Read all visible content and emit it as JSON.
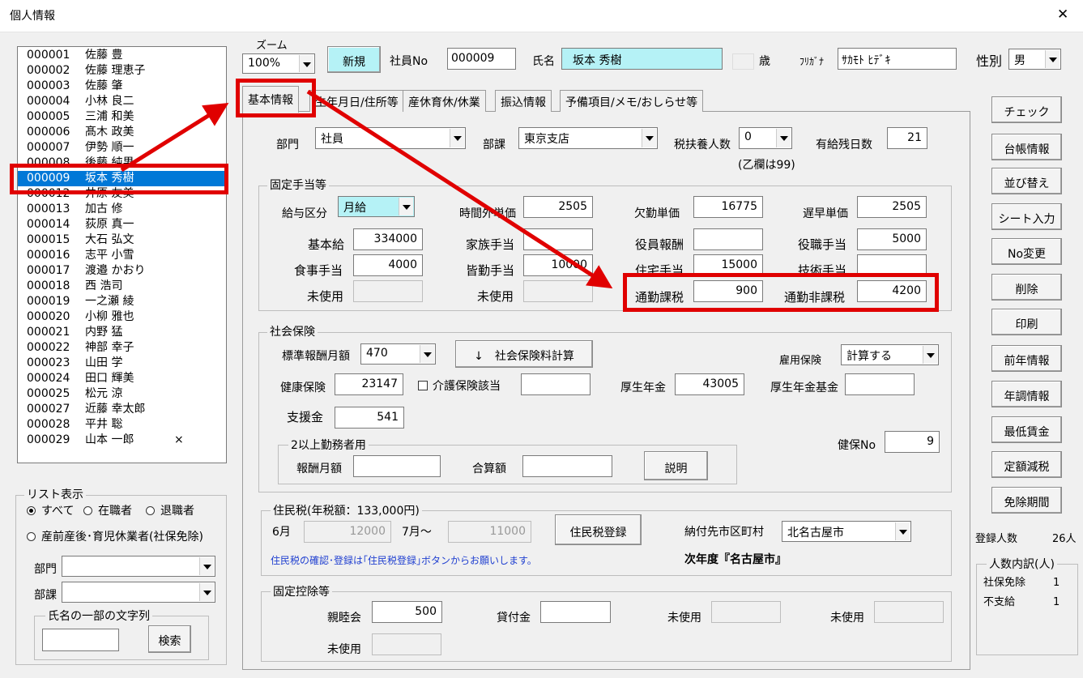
{
  "window": {
    "title": "個人情報",
    "close_glyph": "✕"
  },
  "zoom": {
    "label": "ズーム",
    "value": "100%"
  },
  "header": {
    "new_button": "新規",
    "emp_no_label": "社員No",
    "emp_no": "000009",
    "name_label": "氏名",
    "name": "坂本 秀樹",
    "age_label": "歳",
    "furigana_label": "ﾌﾘｶﾞﾅ",
    "furigana": "ｻｶﾓﾄ ﾋﾃﾞｷ",
    "gender_label": "性別",
    "gender": "男"
  },
  "employees": [
    {
      "no": "000001",
      "name": "佐藤 豊"
    },
    {
      "no": "000002",
      "name": "佐藤 理恵子"
    },
    {
      "no": "000003",
      "name": "佐藤 肇"
    },
    {
      "no": "000004",
      "name": "小林 良二"
    },
    {
      "no": "000005",
      "name": "三浦 和美"
    },
    {
      "no": "000006",
      "name": "髙木 政美"
    },
    {
      "no": "000007",
      "name": "伊勢 順一"
    },
    {
      "no": "000008",
      "name": "後藤 純男"
    },
    {
      "no": "000009",
      "name": "坂本 秀樹"
    },
    {
      "no": "000012",
      "name": "井原 友美"
    },
    {
      "no": "000013",
      "name": "加古 修"
    },
    {
      "no": "000014",
      "name": "荻原 真一"
    },
    {
      "no": "000015",
      "name": "大石 弘文"
    },
    {
      "no": "000016",
      "name": "志平 小雪"
    },
    {
      "no": "000017",
      "name": "渡邉 かおり"
    },
    {
      "no": "000018",
      "name": "西 浩司"
    },
    {
      "no": "000019",
      "name": "一之瀬 綾"
    },
    {
      "no": "000020",
      "name": "小柳 雅也"
    },
    {
      "no": "000021",
      "name": "内野 猛"
    },
    {
      "no": "000022",
      "name": "神部 幸子"
    },
    {
      "no": "000023",
      "name": "山田 学"
    },
    {
      "no": "000024",
      "name": "田口 輝美"
    },
    {
      "no": "000025",
      "name": "松元 涼"
    },
    {
      "no": "000027",
      "name": "近藤 幸太郎"
    },
    {
      "no": "000028",
      "name": "平井 聡"
    },
    {
      "no": "000029",
      "name": "山本 一郎",
      "mark": "×"
    }
  ],
  "list_display": {
    "title": "リスト表示",
    "all": "すべて",
    "active": "在職者",
    "retired": "退職者",
    "leave": "産前産後･育児休業者(社保免除)",
    "dept_label": "部門",
    "section_label": "部課",
    "name_search_title": "氏名の一部の文字列",
    "search_button": "検索"
  },
  "tabs": [
    "基本情報",
    "生年月日/住所等",
    "産休育休/休業",
    "振込情報",
    "予備項目/メモ/おしらせ等"
  ],
  "basic": {
    "dept_label": "部門",
    "dept": "社員",
    "section_label": "部課",
    "section": "東京支店",
    "dependents_label": "税扶養人数",
    "dependents": "0",
    "dependents_note": "(乙欄は99)",
    "paid_leave_label": "有給残日数",
    "paid_leave": "21"
  },
  "fixed_allowance": {
    "title": "固定手当等",
    "pay_type_label": "給与区分",
    "pay_type": "月給",
    "overtime_label": "時間外単価",
    "overtime": "2505",
    "absence_label": "欠勤単価",
    "absence": "16775",
    "late_label": "遅早単価",
    "late": "2505",
    "base_label": "基本給",
    "base": "334000",
    "family_label": "家族手当",
    "family": "",
    "officer_label": "役員報酬",
    "officer": "",
    "position_label": "役職手当",
    "position": "5000",
    "meal_label": "食事手当",
    "meal": "4000",
    "attendance_label": "皆勤手当",
    "attendance": "10000",
    "housing_label": "住宅手当",
    "housing": "15000",
    "skill_label": "技術手当",
    "skill": "",
    "unused1_label": "未使用",
    "unused2_label": "未使用",
    "commute_taxable_label": "通勤課税",
    "commute_taxable": "900",
    "commute_nontaxable_label": "通勤非課税",
    "commute_nontaxable": "4200"
  },
  "social_insurance": {
    "title": "社会保険",
    "std_monthly_label": "標準報酬月額",
    "std_monthly": "470",
    "calc_button": "↓　社会保険料計算",
    "employment_label": "雇用保険",
    "employment": "計算する",
    "health_label": "健康保険",
    "health": "23147",
    "care_label": "介護保険該当",
    "pension_label": "厚生年金",
    "pension": "43005",
    "pension_fund_label": "厚生年金基金",
    "support_label": "支援金",
    "support": "541",
    "multi_title": "2以上勤務者用",
    "reward_label": "報酬月額",
    "total_label": "合算額",
    "explain_button": "説明",
    "health_no_label": "健保No",
    "health_no": "9"
  },
  "resident_tax": {
    "title": "住民税(年税額：133,000円)",
    "june_label": "6月",
    "june": "12000",
    "july_label": "7月～",
    "july": "11000",
    "register_button": "住民税登録",
    "municipality_label": "納付先市区町村",
    "municipality": "北名古屋市",
    "note": "住民税の確認･登録は｢住民税登録｣ボタンからお願いします。",
    "next_year": "次年度『名古屋市』"
  },
  "fixed_deduction": {
    "title": "固定控除等",
    "social_label": "親睦会",
    "social": "500",
    "loan_label": "貸付金",
    "unused_label": "未使用"
  },
  "side_buttons": [
    "チェック",
    "台帳情報",
    "並び替え",
    "シート入力",
    "No変更",
    "削除",
    "印刷",
    "前年情報",
    "年調情報",
    "最低賃金",
    "定額減税",
    "免除期間"
  ],
  "summary": {
    "registered_label": "登録人数",
    "registered": "26人",
    "breakdown_title": "人数内訳(人)",
    "exempt_label": "社保免除",
    "exempt": "1",
    "unpaid_label": "不支給",
    "unpaid": "1"
  },
  "colors": {
    "accent_highlight": "#b5f2f6",
    "selection": "#0078d7",
    "annotation_red": "#e00000"
  }
}
